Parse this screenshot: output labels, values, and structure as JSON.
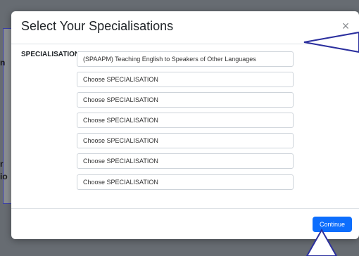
{
  "background": {
    "fragment_1": "n",
    "fragment_2": "r",
    "fragment_3": "io"
  },
  "modal": {
    "title": "Select Your Specialisations",
    "close_glyph": "×",
    "field_label": "SPECIALISATION",
    "selects": [
      "(SPAAPM) Teaching English to Speakers of Other Languages",
      "Choose SPECIALISATION",
      "Choose SPECIALISATION",
      "Choose SPECIALISATION",
      "Choose SPECIALISATION",
      "Choose SPECIALISATION",
      "Choose SPECIALISATION"
    ],
    "continue_label": "Continue"
  },
  "colors": {
    "primary": "#0d6efd",
    "annotation": "#2b2f9e"
  }
}
